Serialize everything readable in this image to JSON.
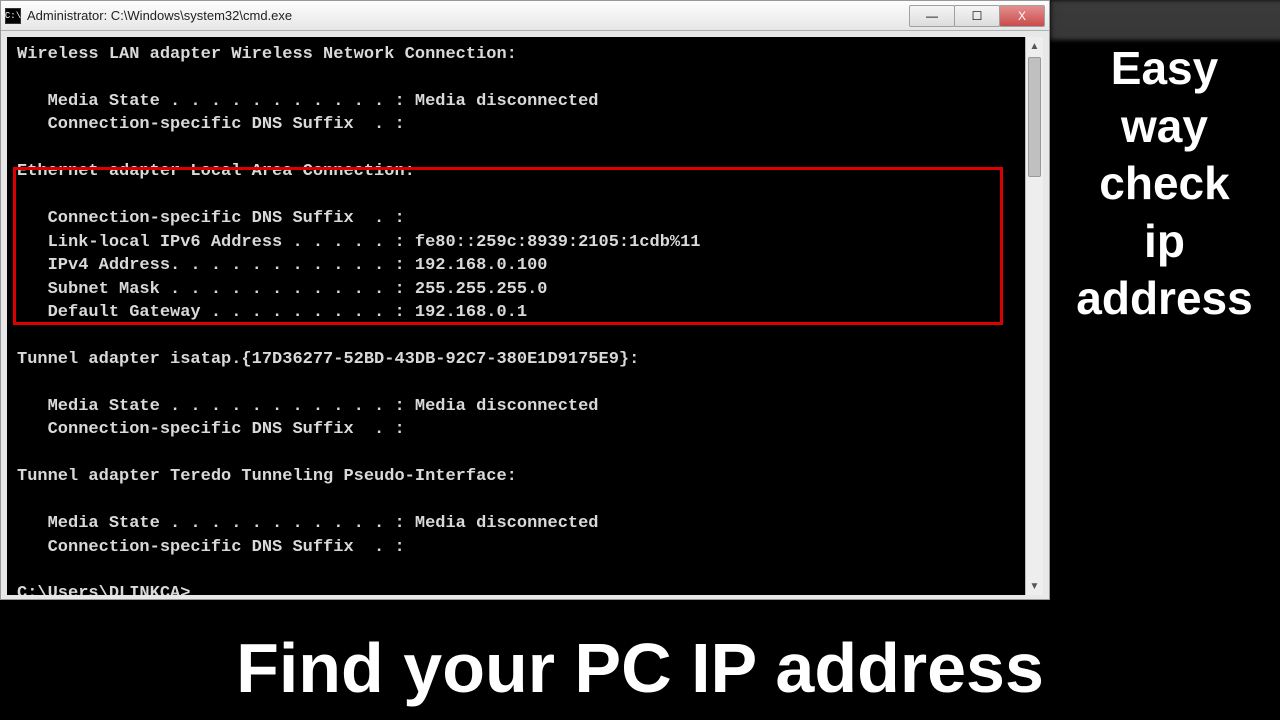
{
  "window": {
    "title": "Administrator: C:\\Windows\\system32\\cmd.exe",
    "icon_glyph": "C:\\",
    "buttons": {
      "min": "—",
      "max": "☐",
      "close": "X"
    }
  },
  "side_caption": [
    "Easy",
    "way",
    "check",
    "ip",
    "address"
  ],
  "bottom_caption": "Find your PC IP address",
  "terminal": {
    "sections": [
      {
        "header": "Wireless LAN adapter Wireless Network Connection:",
        "lines": [
          "   Media State . . . . . . . . . . . : Media disconnected",
          "   Connection-specific DNS Suffix  . :"
        ]
      },
      {
        "header": "Ethernet adapter Local Area Connection:",
        "highlighted": true,
        "lines": [
          "   Connection-specific DNS Suffix  . :",
          "   Link-local IPv6 Address . . . . . : fe80::259c:8939:2105:1cdb%11",
          "   IPv4 Address. . . . . . . . . . . : 192.168.0.100",
          "   Subnet Mask . . . . . . . . . . . : 255.255.255.0",
          "   Default Gateway . . . . . . . . . : 192.168.0.1"
        ]
      },
      {
        "header": "Tunnel adapter isatap.{17D36277-52BD-43DB-92C7-380E1D9175E9}:",
        "lines": [
          "   Media State . . . . . . . . . . . : Media disconnected",
          "   Connection-specific DNS Suffix  . :"
        ]
      },
      {
        "header": "Tunnel adapter Teredo Tunneling Pseudo-Interface:",
        "lines": [
          "   Media State . . . . . . . . . . . : Media disconnected",
          "   Connection-specific DNS Suffix  . :"
        ]
      }
    ],
    "prompt": "C:\\Users\\DLINKCA>"
  }
}
